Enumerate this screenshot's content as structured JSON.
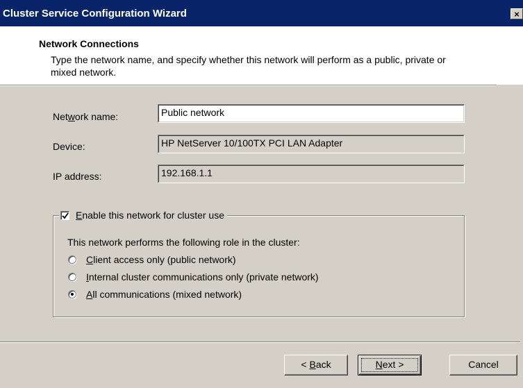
{
  "window": {
    "title": "Cluster Service Configuration Wizard",
    "close_glyph": "×"
  },
  "header": {
    "title": "Network Connections",
    "description": "Type the network name, and specify whether this network will perform as a public, private or mixed network."
  },
  "form": {
    "network_name": {
      "label_pre": "Net",
      "label_key": "w",
      "label_post": "ork name:",
      "value": "Public network"
    },
    "device": {
      "label": "Device:",
      "value": "HP NetServer 10/100TX PCI LAN Adapter"
    },
    "ip_address": {
      "label": "IP address:",
      "value": "192.168.1.1"
    }
  },
  "cluster_use": {
    "checkbox_key": "E",
    "checkbox_label": "nable this network for cluster use",
    "checked": true,
    "role_prompt": "This network performs the following role in the cluster:",
    "roles": [
      {
        "key": "C",
        "label": "lient access only (public network)",
        "selected": false
      },
      {
        "key": "I",
        "label": "nternal cluster communications only (private network)",
        "selected": false
      },
      {
        "key": "A",
        "label": "ll communications (mixed network)",
        "selected": true
      }
    ]
  },
  "buttons": {
    "back_pre": "< ",
    "back_key": "B",
    "back_post": "ack",
    "next_key": "N",
    "next_post": "ext >",
    "cancel": "Cancel"
  }
}
